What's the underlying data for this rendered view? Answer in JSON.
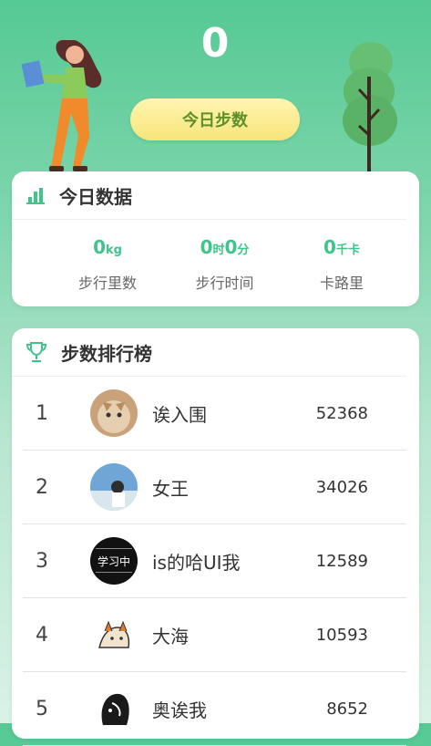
{
  "header": {
    "step_count": "0",
    "today_steps_label": "今日步数"
  },
  "today_data": {
    "title": "今日数据",
    "stats": [
      {
        "value": "0",
        "unit": "kg",
        "label": "步行里数"
      },
      {
        "value_hours": "0",
        "unit_hours": "时",
        "value_minutes": "0",
        "unit_minutes": "分",
        "label": "步行时间"
      },
      {
        "value": "0",
        "unit": "千卡",
        "label": "卡路里"
      }
    ]
  },
  "ranking": {
    "title": "步数排行榜",
    "rows": [
      {
        "rank": "1",
        "name": "诶入围",
        "steps": "52368",
        "avatar": "cat-avatar"
      },
      {
        "rank": "2",
        "name": "女王",
        "steps": "34026",
        "avatar": "person-beach-avatar"
      },
      {
        "rank": "3",
        "name": "is的哈UI我",
        "steps": "12589",
        "avatar": "study-text-avatar",
        "avatar_text": "学习中"
      },
      {
        "rank": "4",
        "name": "大海",
        "steps": "10593",
        "avatar": "sketch-cat-avatar"
      },
      {
        "rank": "5",
        "name": "奥诶我",
        "steps": "8652",
        "avatar": "ink-portrait-avatar"
      }
    ]
  },
  "colors": {
    "accent_green": "#3fc48a",
    "button_yellow": "#f7e57a",
    "button_text": "#5f8f2b"
  }
}
